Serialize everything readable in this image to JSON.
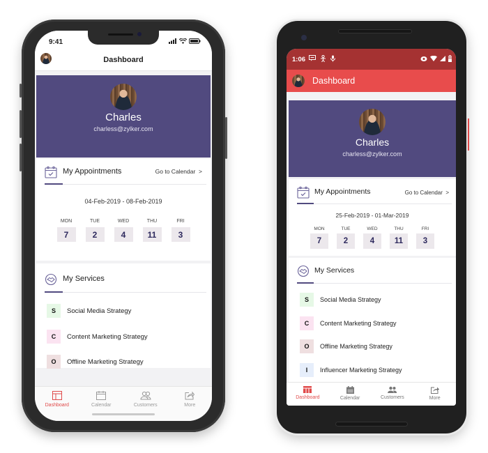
{
  "iphone": {
    "status": {
      "time": "9:41",
      "icons": [
        "signal-icon",
        "wifi-icon",
        "battery-icon"
      ]
    },
    "header": {
      "title": "Dashboard"
    },
    "profile": {
      "name": "Charles",
      "email": "charless@zylker.com"
    },
    "appointments": {
      "title": "My Appointments",
      "link": "Go to Calendar  >",
      "date_range": "04-Feb-2019 - 08-Feb-2019",
      "days": [
        {
          "day": "MON",
          "count": "7"
        },
        {
          "day": "TUE",
          "count": "2"
        },
        {
          "day": "WED",
          "count": "4"
        },
        {
          "day": "THU",
          "count": "11"
        },
        {
          "day": "FRI",
          "count": "3"
        }
      ]
    },
    "services": {
      "title": "My Services",
      "items": [
        {
          "initial": "S",
          "label": "Social Media Strategy",
          "color": "#e6f8e6"
        },
        {
          "initial": "C",
          "label": "Content Marketing Strategy",
          "color": "#fbe3f1"
        },
        {
          "initial": "O",
          "label": "Offline Marketing Strategy",
          "color": "#efdfe0"
        }
      ]
    },
    "tabs": [
      {
        "label": "Dashboard",
        "icon": "dashboard-icon",
        "active": true
      },
      {
        "label": "Calendar",
        "icon": "calendar-icon",
        "active": false
      },
      {
        "label": "Customers",
        "icon": "customers-icon",
        "active": false
      },
      {
        "label": "More",
        "icon": "share-icon",
        "active": false
      }
    ]
  },
  "android": {
    "status": {
      "time": "1:06"
    },
    "header": {
      "title": "Dashboard"
    },
    "profile": {
      "name": "Charles",
      "email": "charless@zylker.com"
    },
    "appointments": {
      "title": "My Appointments",
      "link": "Go to Calendar  >",
      "date_range": "25-Feb-2019 - 01-Mar-2019",
      "days": [
        {
          "day": "MON",
          "count": "7"
        },
        {
          "day": "TUE",
          "count": "2"
        },
        {
          "day": "WED",
          "count": "4"
        },
        {
          "day": "THU",
          "count": "11"
        },
        {
          "day": "FRI",
          "count": "3"
        }
      ]
    },
    "services": {
      "title": "My Services",
      "items": [
        {
          "initial": "S",
          "label": "Social Media Strategy",
          "color": "#e6f8e6"
        },
        {
          "initial": "C",
          "label": "Content Marketing Strategy",
          "color": "#fbe3f1"
        },
        {
          "initial": "O",
          "label": "Offline Marketing Strategy",
          "color": "#efdfe0"
        },
        {
          "initial": "I",
          "label": "Influencer Marketing Strategy",
          "color": "#e6eefb"
        }
      ]
    },
    "tabs": [
      {
        "label": "Dashboard",
        "icon": "dashboard-icon",
        "active": true
      },
      {
        "label": "Calendar",
        "icon": "calendar-icon",
        "active": false
      },
      {
        "label": "Customers",
        "icon": "customers-icon",
        "active": false
      },
      {
        "label": "More",
        "icon": "share-icon",
        "active": false
      }
    ]
  },
  "theme": {
    "accent": "#e84c4c",
    "profile_bg": "#514a7f",
    "count_color": "#2e2a5e"
  }
}
